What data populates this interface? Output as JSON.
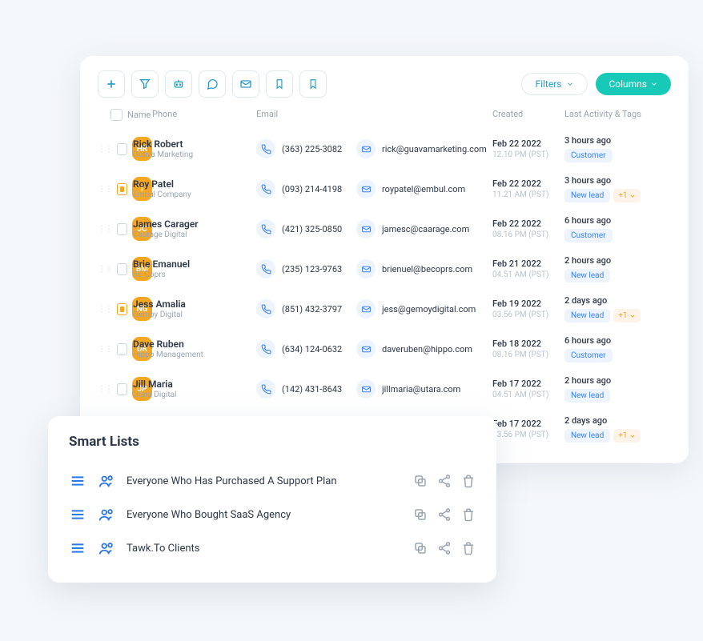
{
  "toolbar": {
    "filters_label": "Filters",
    "columns_label": "Columns"
  },
  "headers": {
    "name": "Name",
    "phone": "Phone",
    "email": "Email",
    "created": "Created",
    "activity": "Last Activity & Tags"
  },
  "contacts": [
    {
      "initials": "HR",
      "name": "Rick Robert",
      "company": "Guava Marketing",
      "phone": "(363) 225-3082",
      "email": "rick@guavamarketing.com",
      "date": "Feb 22 2022",
      "time": "12.10 PM (PST)",
      "activity": "3 hours ago",
      "tags": [
        "Customer"
      ],
      "more": "",
      "checked": false
    },
    {
      "initials": "I",
      "name": "Roy Patel",
      "company": "Embul Company",
      "phone": "(093) 214-4198",
      "email": "roypatel@embul.com",
      "date": "Feb 22 2022",
      "time": "11.21 AM (PST)",
      "activity": "3 hours ago",
      "tags": [
        "New lead"
      ],
      "more": "+1",
      "checked": true
    },
    {
      "initials": "JC",
      "name": "James Carager",
      "company": "Caarage Digital",
      "phone": "(421) 325-0850",
      "email": "jamesc@caarage.com",
      "date": "Feb 22 2022",
      "time": "08.16 PM (PST)",
      "activity": "6 hours ago",
      "tags": [
        "Customer"
      ],
      "more": "",
      "checked": false
    },
    {
      "initials": "BM",
      "name": "Brie Emanuel",
      "company": "BE Coprs",
      "phone": "(235) 123-9763",
      "email": "brienuel@becoprs.com",
      "date": "Feb 21 2022",
      "time": "04.51 AM (PST)",
      "activity": "2 hours ago",
      "tags": [
        "New lead"
      ],
      "more": "",
      "checked": false
    },
    {
      "initials": "NG",
      "name": "Jess Amalia",
      "company": "Gemoy Digital",
      "phone": "(851) 432-3797",
      "email": "jess@gemoydigital.com",
      "date": "Feb 19 2022",
      "time": "03.56 PM (PST)",
      "activity": "2 days ago",
      "tags": [
        "New lead"
      ],
      "more": "+1",
      "checked": true
    },
    {
      "initials": "DR",
      "name": "Dave Ruben",
      "company": "Hippo Management",
      "phone": "(634) 124-0632",
      "email": "daveruben@hippo.com",
      "date": "Feb 18 2022",
      "time": "08.16 PM (PST)",
      "activity": "6 hours ago",
      "tags": [
        "Customer"
      ],
      "more": "",
      "checked": false
    },
    {
      "initials": "JP",
      "name": "Jill Maria",
      "company": "Utara Digital",
      "phone": "(142) 431-8643",
      "email": "jillmaria@utara.com",
      "date": "Feb 17 2022",
      "time": "04.51 AM (PST)",
      "activity": "2 hours ago",
      "tags": [
        "New lead"
      ],
      "more": "",
      "checked": false
    }
  ],
  "extra_row": {
    "date": "Feb 17 2022",
    "time": "03.56 PM (PST)",
    "activity": "2 days ago",
    "tags": [
      "New lead"
    ],
    "more": "+1"
  },
  "smart_lists": {
    "title": "Smart Lists",
    "items": [
      {
        "label": "Everyone Who Has Purchased A Support Plan"
      },
      {
        "label": "Everyone Who Bought SaaS Agency"
      },
      {
        "label": "Tawk.To Clients"
      }
    ]
  }
}
